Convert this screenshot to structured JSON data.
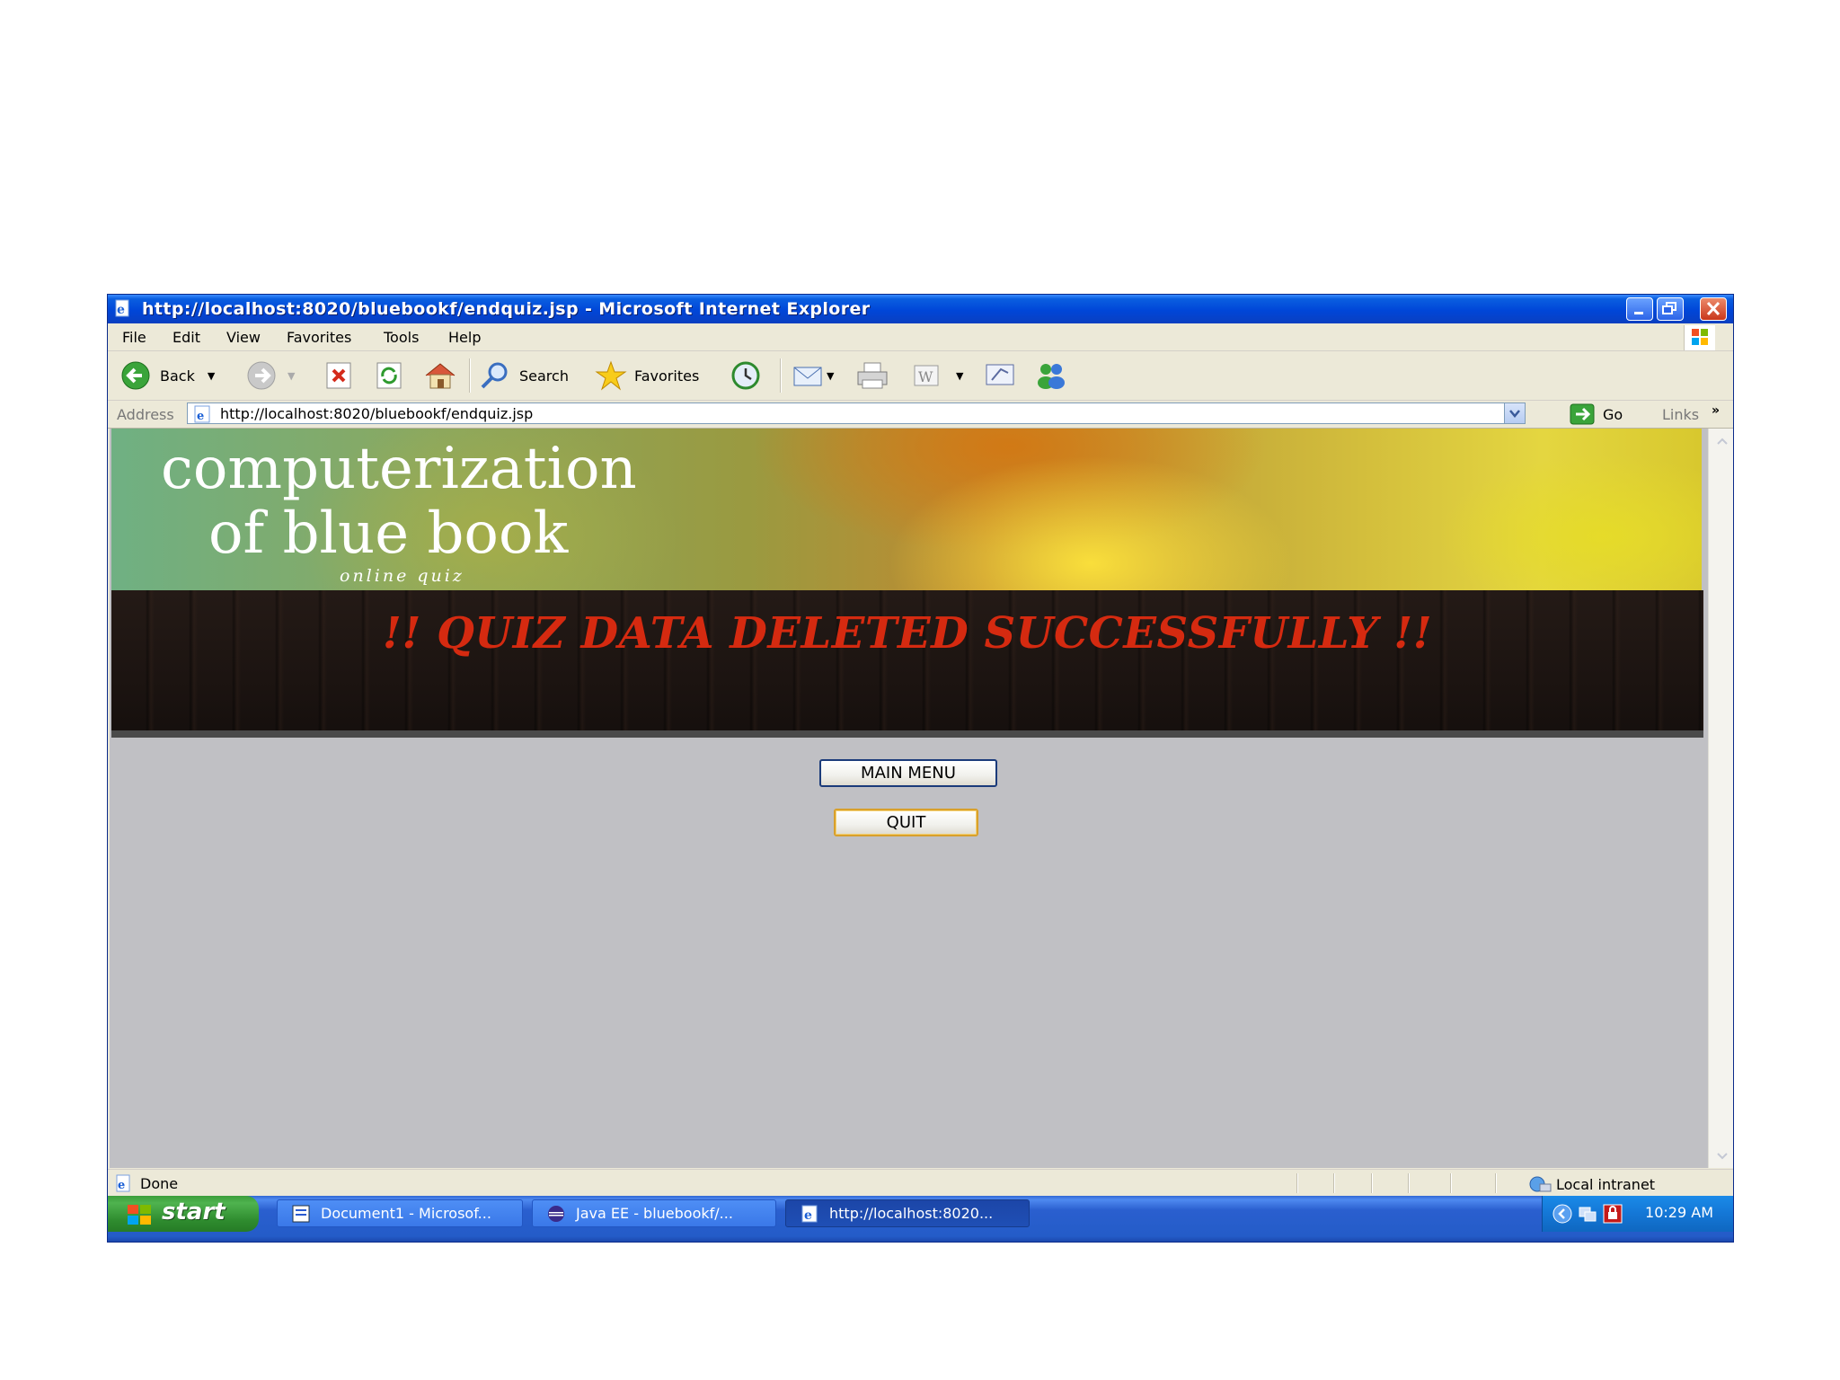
{
  "window": {
    "title": "http://localhost:8020/bluebookf/endquiz.jsp - Microsoft Internet Explorer"
  },
  "menu": {
    "items": [
      "File",
      "Edit",
      "View",
      "Favorites",
      "Tools",
      "Help"
    ]
  },
  "toolbar": {
    "back_label": "Back",
    "search_label": "Search",
    "favorites_label": "Favorites"
  },
  "address": {
    "label": "Address",
    "url": "http://localhost:8020/bluebookf/endquiz.jsp",
    "go_label": "Go",
    "links_label": "Links"
  },
  "page": {
    "banner_line1": "computerization",
    "banner_line2": "of blue book",
    "banner_subtitle": "online quiz",
    "message": "!! QUIZ DATA DELETED SUCCESSFULLY !!",
    "main_menu_button": "MAIN MENU",
    "quit_button": "QUIT"
  },
  "statusbar": {
    "status": "Done",
    "zone": "Local intranet"
  },
  "taskbar": {
    "start_label": "start",
    "tasks": [
      "Document1 - Microsof...",
      "Java EE - bluebookf/...",
      "http://localhost:8020..."
    ],
    "clock": "10:29 AM"
  },
  "colors": {
    "message": "#d52a10",
    "content_bg": "#c0c0c4",
    "titlebar": "#0046d8"
  },
  "icons": {
    "title": "ie-page-icon",
    "back": "back-arrow-icon",
    "forward": "forward-arrow-icon",
    "stop": "stop-icon",
    "refresh": "refresh-icon",
    "home": "home-icon",
    "search": "search-icon",
    "favorites": "favorites-star-icon",
    "history": "history-icon",
    "mail": "mail-icon",
    "print": "print-icon",
    "edit": "edit-icon",
    "discuss": "discuss-icon",
    "messenger": "messenger-icon"
  }
}
